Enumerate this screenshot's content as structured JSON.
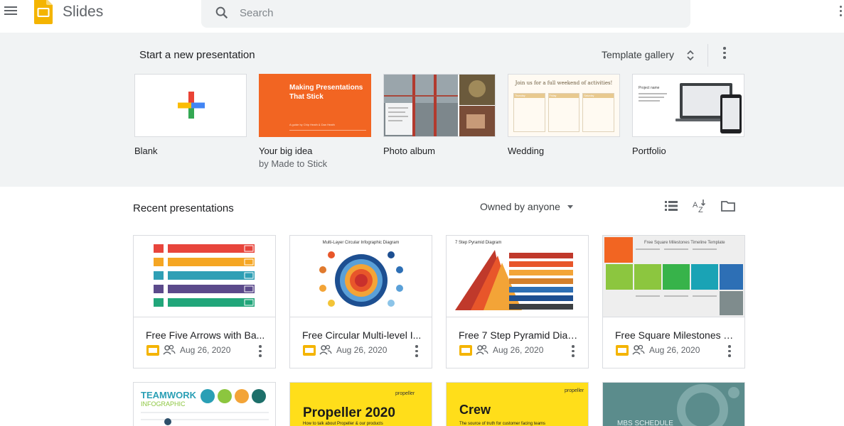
{
  "header": {
    "app_name": "Slides",
    "search_placeholder": "Search"
  },
  "templates": {
    "title": "Start a new presentation",
    "gallery_label": "Template gallery",
    "items": [
      {
        "label": "Blank",
        "sub": ""
      },
      {
        "label": "Your big idea",
        "sub": "by Made to Stick",
        "thumb_title": "Making Presentations That Stick",
        "thumb_byline": "A guide by Chip Heath & Dan Heath"
      },
      {
        "label": "Photo album",
        "sub": ""
      },
      {
        "label": "Wedding",
        "sub": "",
        "thumb_title": "Join us for a full weekend of activities!",
        "thumb_cols": [
          "Thursday",
          "Friday",
          "Saturday"
        ]
      },
      {
        "label": "Portfolio",
        "sub": "",
        "thumb_title": "Project name"
      }
    ]
  },
  "recent": {
    "title": "Recent presentations",
    "owner_filter": "Owned by anyone",
    "files": [
      {
        "title": "Free Five Arrows with Ba...",
        "date": "Aug 26, 2020"
      },
      {
        "title": "Free Circular Multi-level I...",
        "date": "Aug 26, 2020",
        "thumb_title": "Multi-Layer Circular Infographic Diagram"
      },
      {
        "title": "Free 7 Step Pyramid Diagr...",
        "date": "Aug 26, 2020",
        "thumb_title": "7 Step Pyramid Diagram"
      },
      {
        "title": "Free Square Milestones Ti...",
        "date": "Aug 26, 2020",
        "thumb_title": "Free Square Milestones Timeline Template"
      }
    ],
    "row2": [
      {
        "thumb_title": "TEAMWORK",
        "thumb_sub": "INFOGRAPHIC"
      },
      {
        "thumb_title": "Propeller 2020",
        "thumb_sub": "How to talk about Propeller & our products",
        "brand": "propeller"
      },
      {
        "thumb_title": "Crew",
        "thumb_sub": "The source of truth for customer facing teams",
        "brand": "propeller"
      },
      {
        "thumb_title": "MBS SCHEDULE"
      }
    ]
  },
  "colors": {
    "brand_yellow": "#f4b400",
    "template_bg": "#f1f3f4",
    "accent_orange": "#f26522"
  },
  "icons": [
    "menu-icon",
    "slides-logo-icon",
    "search-icon",
    "apps-icon",
    "unfold-icon",
    "more-vert-icon",
    "list-view-icon",
    "sort-az-icon",
    "folder-icon",
    "shared-icon"
  ]
}
